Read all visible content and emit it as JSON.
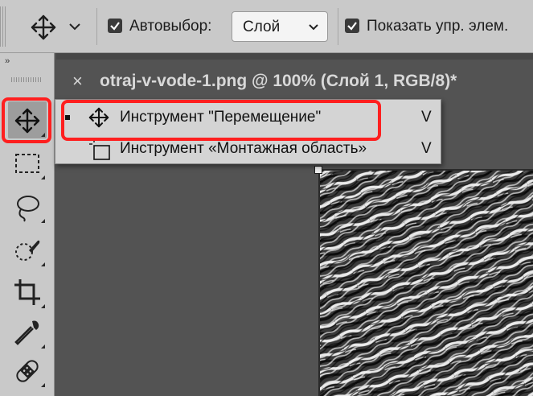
{
  "options_bar": {
    "tool_icon": "move-icon",
    "dropdown_icon": "chevron-down-icon",
    "auto_select": {
      "checked": true,
      "label": "Автовыбор:"
    },
    "auto_select_target": {
      "value": "Слой"
    },
    "show_transform": {
      "checked": true,
      "label": "Показать упр. элем."
    }
  },
  "document_tab": {
    "close_glyph": "×",
    "title": "otraj-v-vode-1.png @ 100% (Слой 1, RGB/8)*"
  },
  "tools_panel": {
    "collapse_glyph": "››",
    "tools": [
      {
        "name": "move-tool",
        "icon": "move-icon",
        "selected": true
      },
      {
        "name": "marquee-tool",
        "icon": "rectangle-marquee-icon"
      },
      {
        "name": "lasso-tool",
        "icon": "lasso-icon"
      },
      {
        "name": "quick-selection-tool",
        "icon": "quick-selection-icon"
      },
      {
        "name": "crop-tool",
        "icon": "crop-icon"
      },
      {
        "name": "eyedropper-tool",
        "icon": "eyedropper-icon"
      },
      {
        "name": "healing-brush-tool",
        "icon": "bandage-icon"
      }
    ]
  },
  "flyout_menu": {
    "items": [
      {
        "label": "Инструмент \"Перемещение\"",
        "shortcut": "V",
        "icon": "move-icon",
        "active": true
      },
      {
        "label": "Инструмент «Монтажная область»",
        "shortcut": "V",
        "icon": "artboard-icon",
        "active": false
      }
    ]
  },
  "colors": {
    "highlight": "#ff1f1f",
    "panel": "#c9c9c9",
    "workspace": "#535353"
  }
}
